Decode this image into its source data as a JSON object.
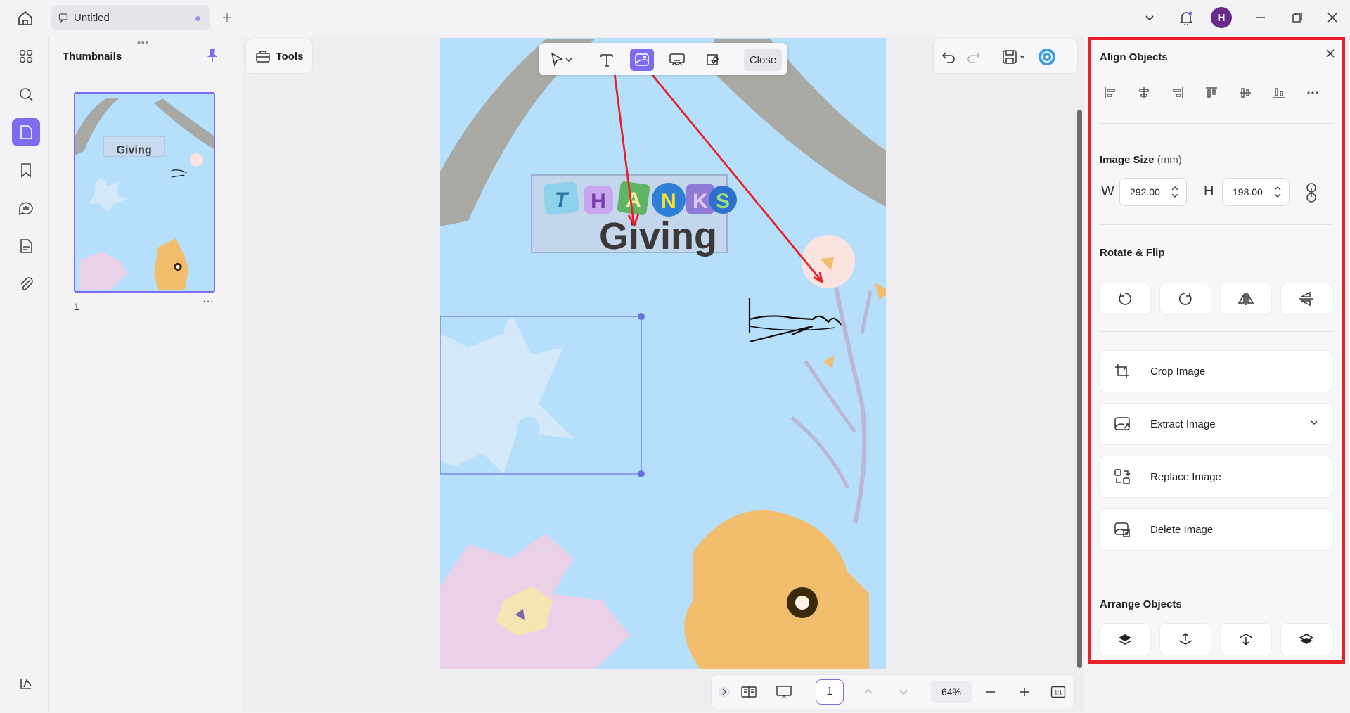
{
  "tab": {
    "title": "Untitled"
  },
  "user": {
    "initial": "H"
  },
  "thumbnails": {
    "title": "Thumbnails",
    "page_label": "1",
    "more": "···"
  },
  "tools": {
    "label": "Tools"
  },
  "edit_toolbar": {
    "close_label": "Close"
  },
  "document": {
    "heading_letters": [
      "T",
      "H",
      "A",
      "N",
      "K",
      "S"
    ],
    "heading_word": "Giving"
  },
  "bottom_bar": {
    "page_number": "1",
    "zoom": "64%",
    "fit_label": "1:1"
  },
  "panel": {
    "align_title": "Align Objects",
    "size_title": "Image Size",
    "size_unit": "(mm)",
    "width_label": "W",
    "height_label": "H",
    "width_value": "292.00",
    "height_value": "198.00",
    "rotate_title": "Rotate & Flip",
    "actions": {
      "crop": "Crop Image",
      "extract": "Extract Image",
      "replace": "Replace Image",
      "delete": "Delete Image"
    },
    "arrange_title": "Arrange Objects"
  },
  "colors": {
    "accent": "#7d6cf0",
    "highlight": "#e8202a",
    "page_bg": "#b5dffb",
    "avatar": "#6a2a8c"
  }
}
